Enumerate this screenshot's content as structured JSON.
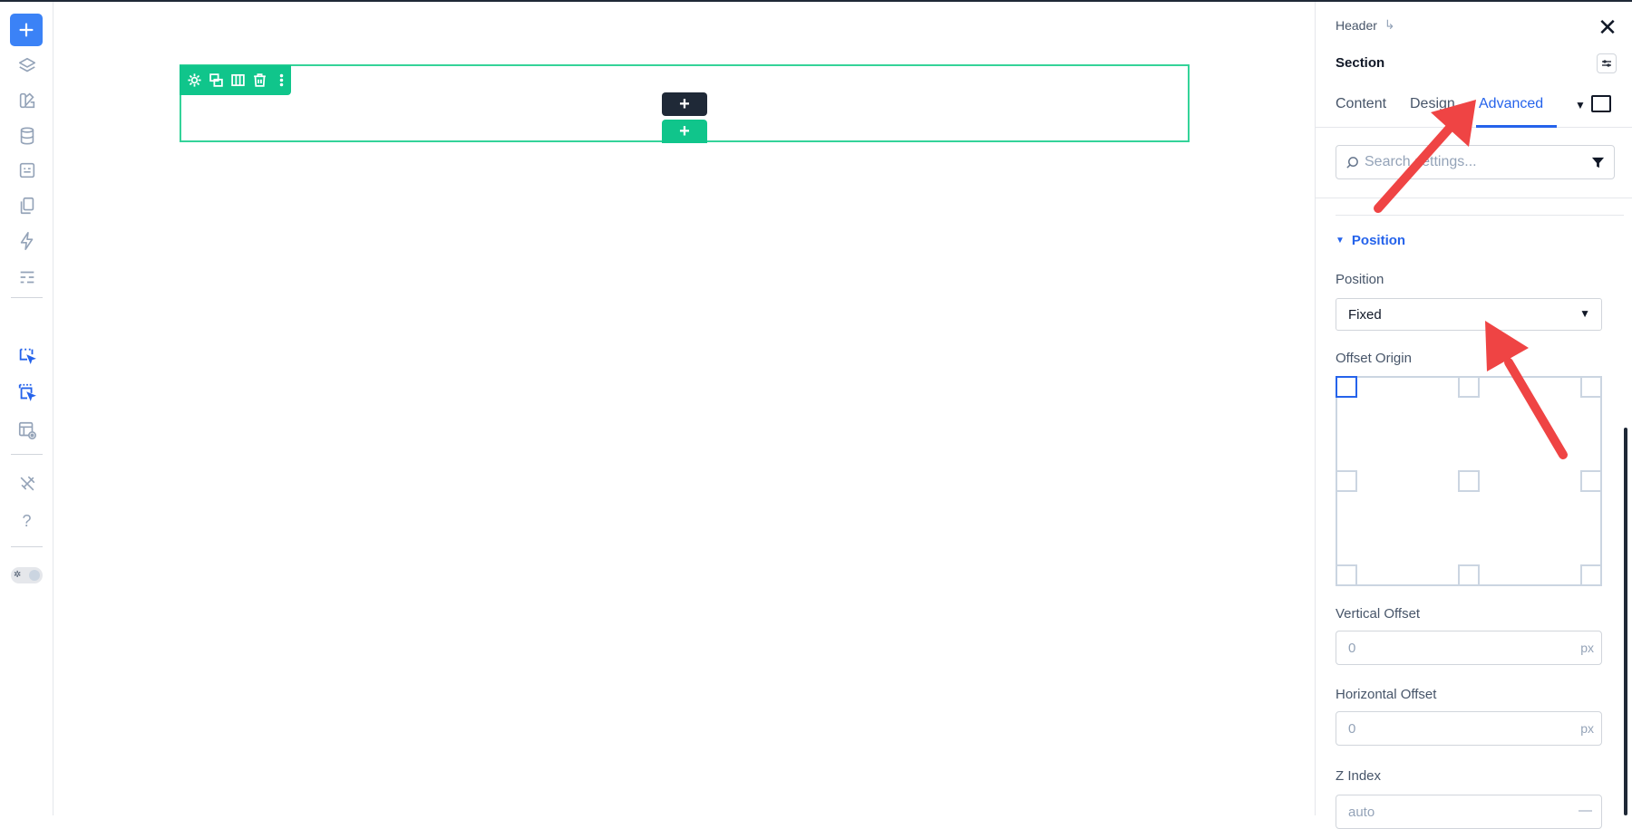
{
  "rail": {
    "items": [
      {
        "name": "add-element"
      },
      {
        "name": "layers"
      },
      {
        "name": "styles"
      },
      {
        "name": "data"
      },
      {
        "name": "forms"
      },
      {
        "name": "pages"
      },
      {
        "name": "interactions"
      },
      {
        "name": "templates"
      },
      {
        "name": "select-element"
      },
      {
        "name": "select-multiple"
      },
      {
        "name": "preview"
      },
      {
        "name": "tools"
      },
      {
        "name": "help"
      }
    ],
    "help_glyph": "?",
    "theme_glyph": "✲"
  },
  "canvas": {
    "add_above_label": "+",
    "add_below_label": "+"
  },
  "panel": {
    "breadcrumb": "Header",
    "breadcrumb_icon": "↳",
    "close_glyph": "✕",
    "title": "Section",
    "tabs": [
      {
        "label": "Content",
        "active": false
      },
      {
        "label": "Design",
        "active": false
      },
      {
        "label": "Advanced",
        "active": true
      }
    ],
    "tab_caret": "▼",
    "search": {
      "placeholder": "Search settings..."
    },
    "group": {
      "title": "Position",
      "caret": "▼"
    },
    "position": {
      "label": "Position",
      "value": "Fixed",
      "arrow": "▼"
    },
    "offset_origin": {
      "label": "Offset Origin",
      "selected": "top-left"
    },
    "vertical_offset": {
      "label": "Vertical Offset",
      "placeholder": "0",
      "unit": "px"
    },
    "horizontal_offset": {
      "label": "Horizontal Offset",
      "placeholder": "0",
      "unit": "px"
    },
    "z_index": {
      "label": "Z Index",
      "placeholder": "auto",
      "unit": "—"
    }
  },
  "colors": {
    "accent": "#2563eb",
    "green": "#10c58b",
    "annotation": "#ef4444"
  }
}
